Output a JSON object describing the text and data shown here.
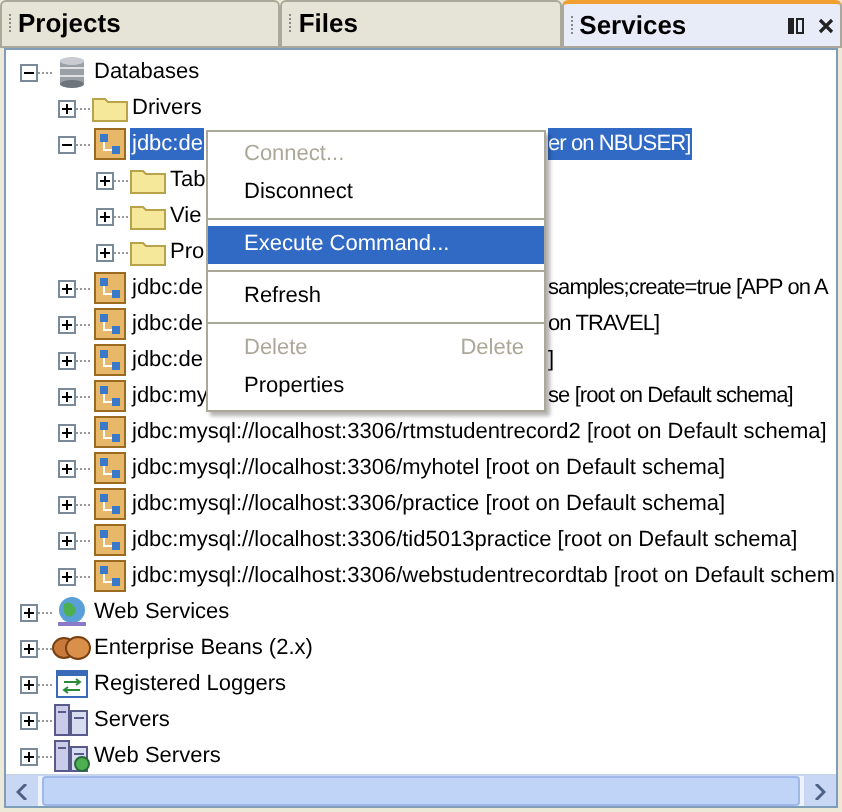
{
  "tabs": [
    {
      "label": "Projects",
      "selected": false
    },
    {
      "label": "Files",
      "selected": false
    },
    {
      "label": "Services",
      "selected": true
    }
  ],
  "tree": [
    {
      "label": "Databases",
      "kind": "database",
      "expanded": true,
      "selected": false,
      "children": [
        {
          "label": "Drivers",
          "kind": "folder",
          "expanded": false,
          "selected": false
        },
        {
          "label": "jdbc:de",
          "label_end": "er on NBUSER]",
          "kind": "connection",
          "expanded": true,
          "selected": true,
          "children": [
            {
              "label": "Tab",
              "kind": "folder",
              "expanded": false,
              "selected": false
            },
            {
              "label": "Vie",
              "kind": "folder",
              "expanded": false,
              "selected": false
            },
            {
              "label": "Pro",
              "kind": "folder",
              "expanded": false,
              "selected": false
            }
          ]
        },
        {
          "label": "jdbc:de",
          "label_end": "samples;create=true [APP on A",
          "kind": "connection",
          "expanded": false,
          "selected": false
        },
        {
          "label": "jdbc:de",
          "label_end": "on TRAVEL]",
          "kind": "connection",
          "expanded": false,
          "selected": false
        },
        {
          "label": "jdbc:de",
          "label_end": "]",
          "kind": "connection",
          "expanded": false,
          "selected": false
        },
        {
          "label": "jdbc:my",
          "label_end": "se [root on Default schema]",
          "kind": "connection",
          "expanded": false,
          "selected": false
        },
        {
          "label": "jdbc:mysql://localhost:3306/rtmstudentrecord2 [root on Default schema]",
          "kind": "connection",
          "expanded": false,
          "selected": false
        },
        {
          "label": "jdbc:mysql://localhost:3306/myhotel [root on Default schema]",
          "kind": "connection",
          "expanded": false,
          "selected": false
        },
        {
          "label": "jdbc:mysql://localhost:3306/practice [root on Default schema]",
          "kind": "connection",
          "expanded": false,
          "selected": false
        },
        {
          "label": "jdbc:mysql://localhost:3306/tid5013practice [root on Default schema]",
          "kind": "connection",
          "expanded": false,
          "selected": false
        },
        {
          "label": "jdbc:mysql://localhost:3306/webstudentrecordtab [root on Default schem",
          "kind": "connection",
          "expanded": false,
          "selected": false
        }
      ]
    },
    {
      "label": "Web Services",
      "kind": "globe",
      "expanded": false,
      "selected": false
    },
    {
      "label": "Enterprise Beans (2.x)",
      "kind": "beans",
      "expanded": false,
      "selected": false
    },
    {
      "label": "Registered Loggers",
      "kind": "logger",
      "expanded": false,
      "selected": false
    },
    {
      "label": "Servers",
      "kind": "server",
      "expanded": false,
      "selected": false
    },
    {
      "label": "Web Servers",
      "kind": "webserver",
      "expanded": false,
      "selected": false
    }
  ],
  "context_menu": [
    {
      "kind": "item",
      "label": "Connect...",
      "disabled": true,
      "selected": false
    },
    {
      "kind": "item",
      "label": "Disconnect",
      "disabled": false,
      "selected": false
    },
    {
      "kind": "separator"
    },
    {
      "kind": "item",
      "label": "Execute Command...",
      "disabled": false,
      "selected": true
    },
    {
      "kind": "separator"
    },
    {
      "kind": "item",
      "label": "Refresh",
      "disabled": false,
      "selected": false
    },
    {
      "kind": "separator"
    },
    {
      "kind": "item",
      "label": "Delete",
      "shortcut": "Delete",
      "disabled": true,
      "selected": false
    },
    {
      "kind": "item",
      "label": "Properties",
      "disabled": false,
      "selected": false
    }
  ]
}
